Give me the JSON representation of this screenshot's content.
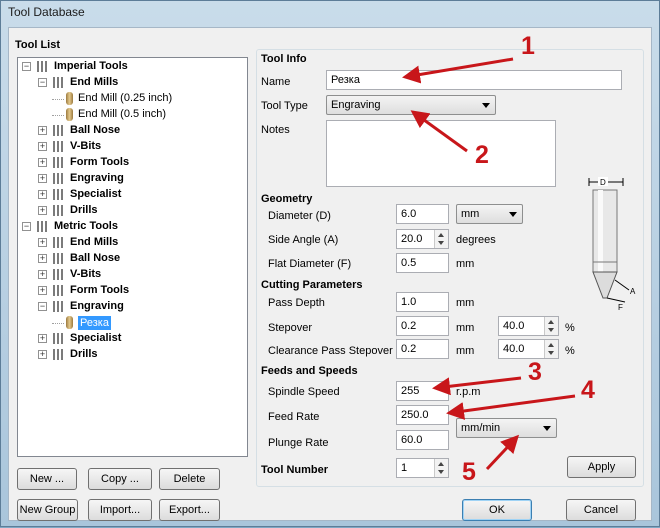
{
  "window": {
    "title": "Tool Database"
  },
  "tool_list": {
    "heading": "Tool List",
    "tree": [
      {
        "label": "Imperial Tools",
        "level": 0,
        "expanded": true
      },
      {
        "label": "End Mills",
        "level": 1,
        "expanded": true
      },
      {
        "label": "End Mill (0.25 inch)",
        "level": 2,
        "leaf": true
      },
      {
        "label": "End Mill (0.5 inch)",
        "level": 2,
        "leaf": true
      },
      {
        "label": "Ball Nose",
        "level": 1
      },
      {
        "label": "V-Bits",
        "level": 1
      },
      {
        "label": "Form Tools",
        "level": 1
      },
      {
        "label": "Engraving",
        "level": 1
      },
      {
        "label": "Specialist",
        "level": 1
      },
      {
        "label": "Drills",
        "level": 1
      },
      {
        "label": "Metric Tools",
        "level": 0,
        "expanded": true
      },
      {
        "label": "End Mills",
        "level": 1
      },
      {
        "label": "Ball Nose",
        "level": 1
      },
      {
        "label": "V-Bits",
        "level": 1
      },
      {
        "label": "Form Tools",
        "level": 1
      },
      {
        "label": "Engraving",
        "level": 1,
        "expanded": true
      },
      {
        "label": "Резка",
        "level": 2,
        "leaf": true,
        "selected": true
      },
      {
        "label": "Specialist",
        "level": 1
      },
      {
        "label": "Drills",
        "level": 1
      }
    ],
    "buttons": {
      "new": "New ...",
      "copy": "Copy ...",
      "delete": "Delete",
      "new_group": "New Group",
      "import": "Import...",
      "export": "Export..."
    }
  },
  "tool_info": {
    "heading": "Tool Info",
    "name_label": "Name",
    "name_value": "Резка",
    "type_label": "Tool Type",
    "type_value": "Engraving",
    "notes_label": "Notes",
    "notes_value": ""
  },
  "geometry": {
    "heading": "Geometry",
    "diameter_label": "Diameter (D)",
    "diameter_value": "6.0",
    "units_value": "mm",
    "side_angle_label": "Side Angle (A)",
    "side_angle_value": "20.0",
    "side_angle_unit": "degrees",
    "flat_diameter_label": "Flat Diameter (F)",
    "flat_diameter_value": "0.5",
    "flat_diameter_unit": "mm",
    "diagram_labels": {
      "d": "D",
      "a": "A",
      "f": "F"
    }
  },
  "cutting": {
    "heading": "Cutting Parameters",
    "pass_depth_label": "Pass Depth",
    "pass_depth_value": "1.0",
    "pass_depth_unit": "mm",
    "stepover_label": "Stepover",
    "stepover_value": "0.2",
    "stepover_unit": "mm",
    "stepover_pct": "40.0",
    "pct_sign": "%",
    "clearance_label": "Clearance Pass Stepover",
    "clearance_value": "0.2",
    "clearance_unit": "mm",
    "clearance_pct": "40.0",
    "clearance_pct_sign": "%"
  },
  "feeds": {
    "heading": "Feeds and Speeds",
    "spindle_label": "Spindle Speed",
    "spindle_value": "255",
    "spindle_unit": "r.p.m",
    "feed_label": "Feed Rate",
    "feed_value": "250.0",
    "plunge_label": "Plunge Rate",
    "plunge_value": "60.0",
    "rate_units": "mm/min"
  },
  "tool_number": {
    "label": "Tool Number",
    "value": "1"
  },
  "buttons": {
    "apply": "Apply",
    "ok": "OK",
    "cancel": "Cancel"
  },
  "annotations": {
    "n1": "1",
    "n2": "2",
    "n3": "3",
    "n4": "4",
    "n5": "5",
    "color": "#c8161a"
  }
}
